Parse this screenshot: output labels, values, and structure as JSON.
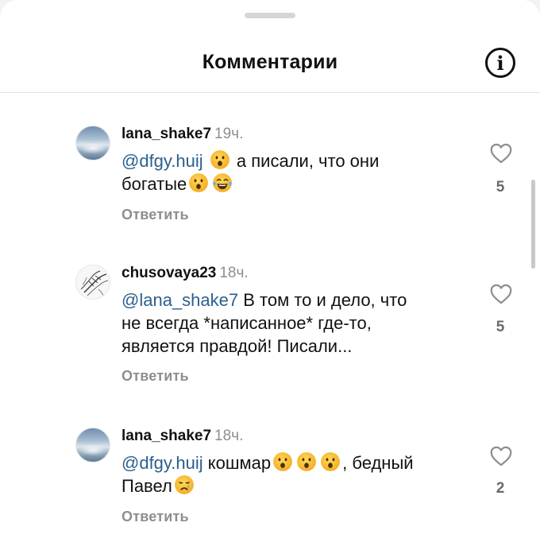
{
  "header": {
    "title": "Комментарии",
    "info_icon": "info-icon",
    "info_glyph": "i"
  },
  "comments": [
    {
      "avatar": "clouds",
      "username": "lana_shake7",
      "time": "19ч.",
      "mention": "@dfgy.huij",
      "text_a": "а писали, что они",
      "text_b": "богатые",
      "reply_label": "Ответить",
      "likes": "5",
      "emojis": [
        "astonished-face-emoji",
        "astonished-face-emoji",
        "tears-of-joy-emoji"
      ]
    },
    {
      "avatar": "sketch",
      "username": "chusovaya23",
      "time": "18ч.",
      "mention": "@lana_shake7",
      "text_a": "В том то и дело, что",
      "text_b": "не всегда *написанное* где-то,",
      "text_c": "является правдой! Писали...",
      "reply_label": "Ответить",
      "likes": "5"
    },
    {
      "avatar": "clouds",
      "username": "lana_shake7",
      "time": "18ч.",
      "mention": "@dfgy.huij",
      "text_a": "кошмар",
      "text_b": ", бедный",
      "text_c": "Павел",
      "reply_label": "Ответить",
      "likes": "2",
      "emojis": [
        "astonished-face-emoji",
        "astonished-face-emoji",
        "astonished-face-emoji",
        "crying-face-emoji"
      ]
    }
  ],
  "colors": {
    "mention": "#2b5f8e",
    "secondary_text": "#8e8e8e",
    "emoji_yellow": "#f7c23b"
  }
}
